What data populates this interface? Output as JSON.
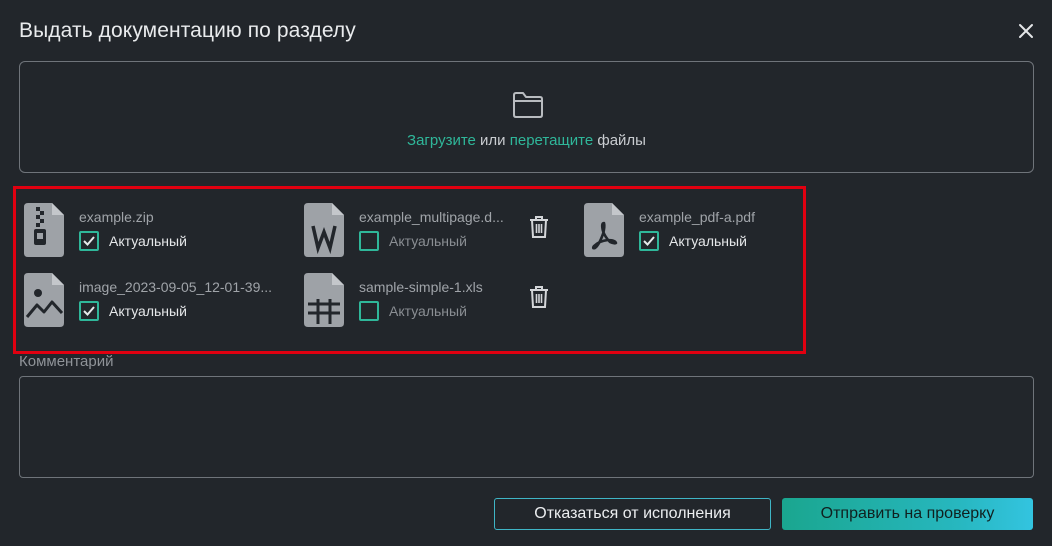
{
  "dialog": {
    "title": "Выдать документацию по разделу",
    "close_icon": "close-icon"
  },
  "dropzone": {
    "icon": "folder-icon",
    "upload_link": "Загрузите",
    "or_text": " или ",
    "drag_link": "перетащите",
    "files_text": " файлы"
  },
  "files": [
    {
      "name": "example.zip",
      "icon": "zip-file-icon",
      "checked": true,
      "status_label": "Актуальный"
    },
    {
      "name": "example_multipage.d...",
      "icon": "word-file-icon",
      "checked": false,
      "status_label": "Актуальный",
      "deletable": true
    },
    {
      "name": "example_pdf-a.pdf",
      "icon": "pdf-file-icon",
      "checked": true,
      "status_label": "Актуальный"
    },
    {
      "name": "image_2023-09-05_12-01-39...",
      "icon": "image-file-icon",
      "checked": true,
      "status_label": "Актуальный"
    },
    {
      "name": "sample-simple-1.xls",
      "icon": "spreadsheet-file-icon",
      "checked": false,
      "status_label": "Актуальный",
      "deletable": true
    }
  ],
  "comment": {
    "label": "Комментарий",
    "value": ""
  },
  "buttons": {
    "cancel": "Отказаться от исполнения",
    "submit": "Отправить на проверку"
  },
  "colors": {
    "background": "#22262b",
    "accent": "#2fb79a",
    "highlight": "#e10010",
    "cancel_border": "#3fb5c6"
  }
}
